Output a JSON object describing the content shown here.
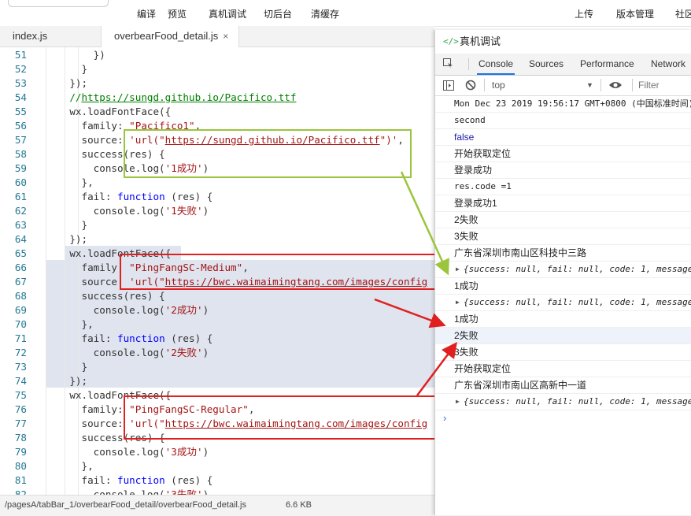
{
  "toolbar": {
    "items": [
      "编译",
      "预览",
      "真机调试",
      "切后台",
      "清缓存",
      "上传",
      "版本管理",
      "社区"
    ]
  },
  "tabs": [
    {
      "label": "index.js",
      "active": false
    },
    {
      "label": "overbearFood_detail.js",
      "active": true,
      "close": "×"
    }
  ],
  "editor": {
    "lines": [
      {
        "n": "51",
        "html": "        })"
      },
      {
        "n": "52",
        "html": "      }"
      },
      {
        "n": "53",
        "html": "    });"
      },
      {
        "n": "54",
        "html": "    <span class=\"cmt\">//<span class=\"url\">https://sungd.github.io/Pacifico.ttf</span></span>"
      },
      {
        "n": "55",
        "html": "    wx.loadFontFace({"
      },
      {
        "n": "56",
        "html": "      family: <span class=\"str\">\"Pacifico1\"</span>,"
      },
      {
        "n": "57",
        "html": "      source: <span class=\"str\">'url(\"<span class=\"url\">https://sungd.github.io/Pacifico.ttf</span>\")'</span>,"
      },
      {
        "n": "58",
        "html": "      success(res) {"
      },
      {
        "n": "59",
        "html": "        console.log(<span class=\"str\">'1成功'</span>)"
      },
      {
        "n": "60",
        "html": "      },"
      },
      {
        "n": "61",
        "html": "      fail: <span class=\"kw\">function</span> (res) {"
      },
      {
        "n": "62",
        "html": "        console.log(<span class=\"str\">'1失败'</span>)"
      },
      {
        "n": "63",
        "html": "      }"
      },
      {
        "n": "64",
        "html": "    });"
      },
      {
        "n": "65",
        "html": "    wx.loadFontFace({"
      },
      {
        "n": "66",
        "html": "      family: <span class=\"str\">\"PingFangSC-Medium\"</span>,"
      },
      {
        "n": "67",
        "html": "      source: <span class=\"str\">'url(\"<span class=\"url\">https://bwc.waimaimingtang.com/images/config</span></span>"
      },
      {
        "n": "68",
        "html": "      success(res) {"
      },
      {
        "n": "69",
        "html": "        console.log(<span class=\"str\">'2成功'</span>)"
      },
      {
        "n": "70",
        "html": "      },"
      },
      {
        "n": "71",
        "html": "      fail: <span class=\"kw\">function</span> (res) {"
      },
      {
        "n": "72",
        "html": "        console.log(<span class=\"str\">'2失败'</span>)"
      },
      {
        "n": "73",
        "html": "      }"
      },
      {
        "n": "74",
        "html": "    });"
      },
      {
        "n": "75",
        "html": "    wx.loadFontFace({"
      },
      {
        "n": "76",
        "html": "      family: <span class=\"str\">\"PingFangSC-Regular\"</span>,"
      },
      {
        "n": "77",
        "html": "      source: <span class=\"str\">'url(\"<span class=\"url\">https://bwc.waimaimingtang.com/images/config</span></span>"
      },
      {
        "n": "78",
        "html": "      success(res) {"
      },
      {
        "n": "79",
        "html": "        console.log(<span class=\"str\">'3成功'</span>)"
      },
      {
        "n": "80",
        "html": "      },"
      },
      {
        "n": "81",
        "html": "      fail: <span class=\"kw\">function</span> (res) {"
      },
      {
        "n": "82",
        "html": "        console.log(<span class=\"str\">'3失败'</span>)"
      }
    ]
  },
  "statusbar": {
    "path": "/pagesA/tabBar_1/overbearFood_detail/overbearFood_detail.js",
    "size": "6.6 KB"
  },
  "devtools": {
    "title": "真机调试",
    "title_icon": "code-brackets-icon",
    "tabs": [
      "Console",
      "Sources",
      "Performance",
      "Network"
    ],
    "active_tab": "Console",
    "context": "top",
    "filter_placeholder": "Filter",
    "console": [
      {
        "text": "Mon Dec 23 2019 19:56:17 GMT+0800 (中国标准时间)",
        "kind": "mono"
      },
      {
        "text": "second",
        "kind": "mono"
      },
      {
        "text": "false",
        "kind": "blue"
      },
      {
        "text": "开始获取定位",
        "kind": ""
      },
      {
        "text": "登录成功",
        "kind": ""
      },
      {
        "text": "res.code =1",
        "kind": "mono"
      },
      {
        "text": "登录成功1",
        "kind": ""
      },
      {
        "text": "2失败",
        "kind": ""
      },
      {
        "text": "3失败",
        "kind": ""
      },
      {
        "text": "广东省深圳市南山区科技中三路",
        "kind": ""
      },
      {
        "text": "{success: null, fail: null, code: 1, message",
        "kind": "obj"
      },
      {
        "text": "1成功",
        "kind": ""
      },
      {
        "text": "{success: null, fail: null, code: 1, message",
        "kind": "obj"
      },
      {
        "text": "1成功",
        "kind": ""
      },
      {
        "text": "2失败",
        "kind": "",
        "highlight": true
      },
      {
        "text": "3失败",
        "kind": ""
      },
      {
        "text": "开始获取定位",
        "kind": ""
      },
      {
        "text": "广东省深圳市南山区高新中一道",
        "kind": ""
      },
      {
        "text": "{success: null, fail: null, code: 1, message",
        "kind": "obj"
      }
    ],
    "prompt": "›"
  },
  "annotations": {
    "green": "#9bc53d",
    "red": "#e02020"
  }
}
